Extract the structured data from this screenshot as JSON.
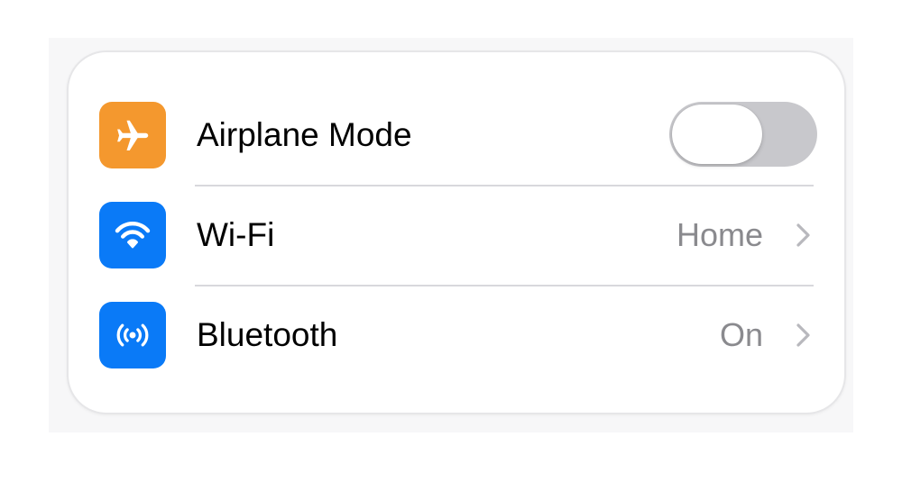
{
  "settings_group": {
    "rows": [
      {
        "label": "Airplane Mode",
        "icon": "airplane-icon",
        "icon_color": "#F4982E",
        "control": "toggle",
        "toggle_on": false
      },
      {
        "label": "Wi-Fi",
        "icon": "wifi-icon",
        "icon_color": "#0A7AF7",
        "value": "Home",
        "control": "chevron"
      },
      {
        "label": "Bluetooth",
        "icon": "bluetooth-icon",
        "icon_color": "#0A7AF7",
        "value": "On",
        "control": "chevron"
      }
    ]
  },
  "colors": {
    "toggle_off_track": "#C8C8CC",
    "secondary_text": "#8A8A8E",
    "chevron": "#B8B8BD"
  }
}
